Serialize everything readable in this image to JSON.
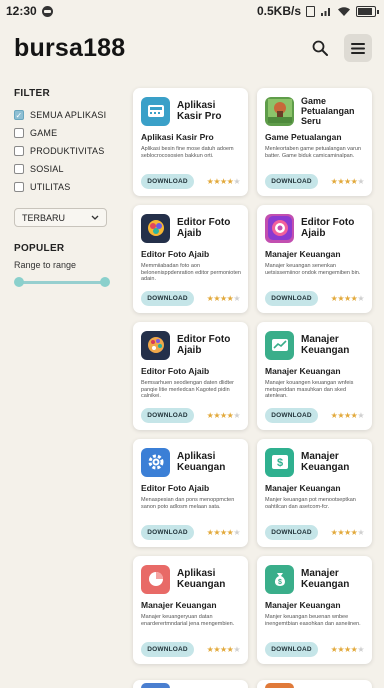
{
  "status": {
    "time": "12:30",
    "speed": "0.5KB/s"
  },
  "header": {
    "logo": "bursa188",
    "search_icon": "search-icon",
    "menu_icon": "menu-icon"
  },
  "sidebar": {
    "filter_title": "FILTER",
    "filters": [
      {
        "label": "SEMUA APLIKASI",
        "checked": true
      },
      {
        "label": "GAME",
        "checked": false
      },
      {
        "label": "PRODUKTIVITAS",
        "checked": false
      },
      {
        "label": "SOSIAL",
        "checked": false
      },
      {
        "label": "UTILITAS",
        "checked": false
      }
    ],
    "sort_value": "TERBARU",
    "popular_title": "POPULER",
    "range_label": "Range to range"
  },
  "apps": [
    {
      "title": "Aplikasi Kasir Pro",
      "subtitle": "Aplikasi Kasir Pro",
      "desc": "Aplikasi besin fine mose datuh adoem seblocrocososien bakkun orti.",
      "download": "DOWNLOAD",
      "rating": 4,
      "icon": "cash-register-icon",
      "color": "#3aa0c8"
    },
    {
      "title": "Game Petualangan Seru",
      "subtitle": "Game Petualangan",
      "desc": "Menleortaben game petualangan varun batter. Game biduk camicaminalpan.",
      "download": "DOWNLOAD",
      "rating": 4,
      "icon": "adventure-game-icon",
      "color": "#5f9d4a"
    },
    {
      "title": "Editor Foto Ajaib",
      "subtitle": "Editor Foto Ajaib",
      "desc": "Memmiiabadan foto aon belonenisppdenration editor permonioten adain.",
      "download": "DOWNLOAD",
      "rating": 4,
      "icon": "photo-editor-icon",
      "color": "#24304a"
    },
    {
      "title": "Editor Foto Ajaib",
      "subtitle": "Manajer Keuangan",
      "desc": "Manajer keuangan senenkan uetsissemiinor ondok mengemiben bin.",
      "download": "DOWNLOAD",
      "rating": 4,
      "icon": "camera-lens-icon",
      "color": "#c24fb0"
    },
    {
      "title": "Editor Foto Ajaib",
      "subtitle": "Editor Foto Ajaib",
      "desc": "Bemsarhuen seodiengan daten dlidter panqie litie merledcan Kagoted pidin calnikei.",
      "download": "DOWNLOAD",
      "rating": 4,
      "icon": "palette-icon",
      "color": "#24304a"
    },
    {
      "title": "Manajer Keuangan",
      "subtitle": "Manajer Keuangan",
      "desc": "Manajer kouangen keuangan wnfeis metspeddan masuhkan dan sked atenlean.",
      "download": "DOWNLOAD",
      "rating": 4,
      "icon": "finance-chart-icon",
      "color": "#3aae8a"
    },
    {
      "title": "Aplikasi Keuangan",
      "subtitle": "Editor Foto Ajaib",
      "desc": "Menaspesian dan pons menoppmcten sanon poto adlosm melaan sata.",
      "download": "DOWNLOAD",
      "rating": 4,
      "icon": "gear-icon",
      "color": "#3b7fd6"
    },
    {
      "title": "Manajer Keuangan",
      "subtitle": "Manajer Keuangan",
      "desc": "Manjer keuangan pot menootseptkan oahtilcan dan asetcom-fcr.",
      "download": "DOWNLOAD",
      "rating": 4,
      "icon": "dollar-icon",
      "color": "#2fb08f"
    },
    {
      "title": "Aplikasi Keuangan",
      "subtitle": "Manajer Keuangan",
      "desc": "Manajer keuangeryuan datan enarderertmndarial jena mengembien.",
      "download": "DOWNLOAD",
      "rating": 4,
      "icon": "pie-chart-icon",
      "color": "#e86a67"
    },
    {
      "title": "Manajer Keuangan",
      "subtitle": "Manajer Keuangan",
      "desc": "Manjer keuangan beuenan wnbee inengemtbian easohkan dan asneiinen.",
      "download": "DOWNLOAD",
      "rating": 4,
      "icon": "money-bag-icon",
      "color": "#3aae8a"
    }
  ],
  "peek_colors": [
    "#4a7fd0",
    "#e07a3a"
  ]
}
